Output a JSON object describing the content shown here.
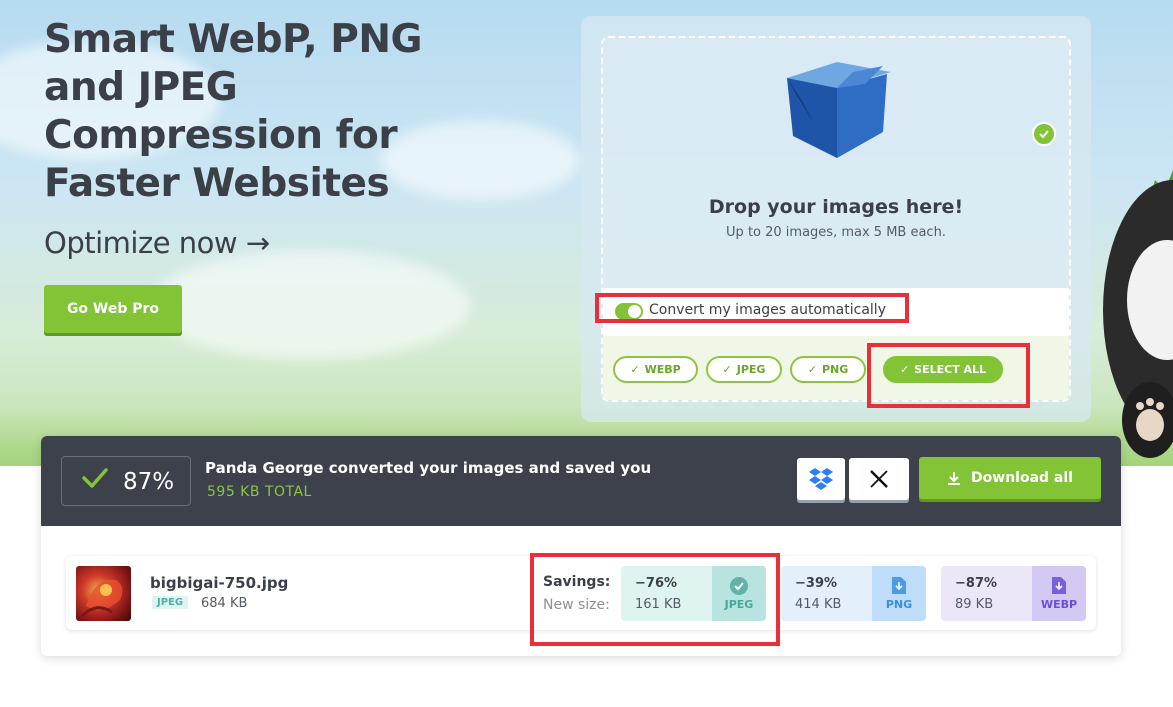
{
  "hero": {
    "headline": "Smart WebP, PNG and JPEG Compression for Faster Websites",
    "optimize": "Optimize now →",
    "pro_button": "Go Web Pro"
  },
  "dropzone": {
    "title": "Drop your images here!",
    "subtitle": "Up to 20 images, max 5 MB each.",
    "convert_label": "Convert my images automatically",
    "convert_enabled": true,
    "formats": [
      {
        "label": "WEBP",
        "selected": false
      },
      {
        "label": "JPEG",
        "selected": false
      },
      {
        "label": "PNG",
        "selected": false
      },
      {
        "label": "SELECT ALL",
        "selected": true
      }
    ]
  },
  "results": {
    "percent": "87%",
    "message": "Panda George converted your images and saved you",
    "total": "595 KB TOTAL",
    "share": [
      "dropbox-icon",
      "x-icon"
    ],
    "download_label": "Download all",
    "file": {
      "name": "bigbigai-750.jpg",
      "type": "JPEG",
      "size": "684 KB",
      "savings_label": "Savings:",
      "newsize_label": "New size:",
      "outputs": [
        {
          "pct": "−76%",
          "size": "161 KB",
          "format": "JPEG",
          "color": "#dff3f1",
          "tag_color": "#b9e3de"
        },
        {
          "pct": "−39%",
          "size": "414 KB",
          "format": "PNG",
          "color": "#e3effb",
          "tag_color": "#bfdcf8"
        },
        {
          "pct": "−87%",
          "size": "89 KB",
          "format": "WEBP",
          "color": "#ebe7f8",
          "tag_color": "#d3c9f3"
        }
      ]
    }
  },
  "colors": {
    "accent": "#83c336",
    "dark_panel": "#3d414b",
    "highlight": "#e8303a"
  }
}
